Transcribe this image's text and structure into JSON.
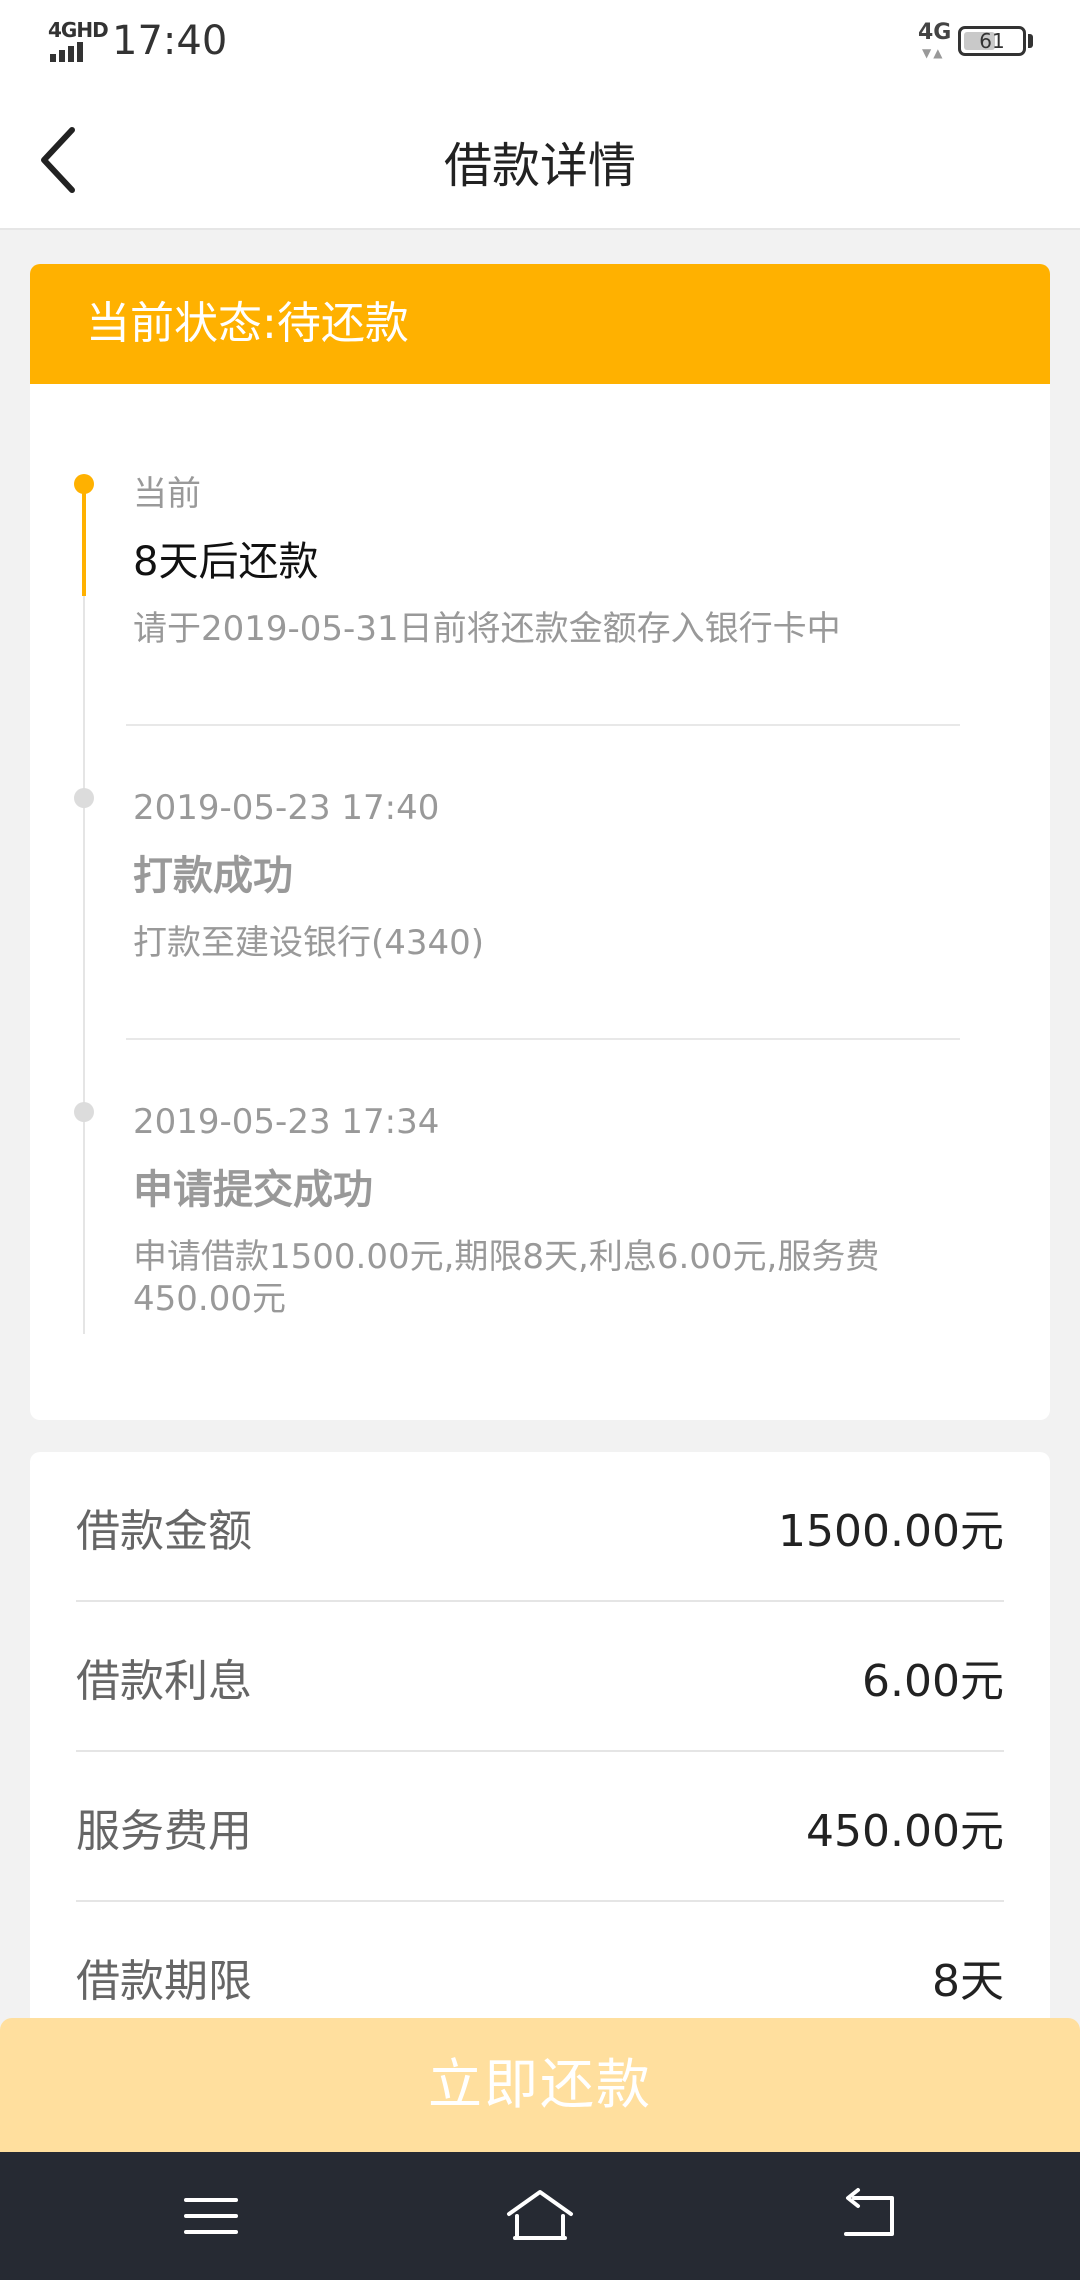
{
  "status_bar": {
    "network_type": "4GHD",
    "time": "17:40",
    "mobile_network": "4G",
    "battery_level": "61"
  },
  "nav": {
    "title": "借款详情",
    "back_icon": "chevron-left-icon"
  },
  "status_card": {
    "header": "当前状态:待还款",
    "accent_color": "#ffb100",
    "timeline": [
      {
        "label": "当前",
        "title": "8天后还款",
        "desc": "请于2019-05-31日前将还款金额存入银行卡中",
        "active": true
      },
      {
        "label": "2019-05-23 17:40",
        "title": "打款成功",
        "desc": "打款至建设银行(4340)",
        "active": false
      },
      {
        "label": "2019-05-23 17:34",
        "title": "申请提交成功",
        "desc": "申请借款1500.00元,期限8天,利息6.00元,服务费450.00元",
        "active": false
      }
    ]
  },
  "details": [
    {
      "key": "借款金额",
      "value": "1500.00元"
    },
    {
      "key": "借款利息",
      "value": "6.00元"
    },
    {
      "key": "服务费用",
      "value": "450.00元"
    },
    {
      "key": "借款期限",
      "value": "8天"
    }
  ],
  "repay_button": {
    "label": "立即还款",
    "color": "#ffdf9e"
  },
  "system_nav": {
    "menu_icon": "menu-icon",
    "home_icon": "home-icon",
    "back_icon": "back-arrow-icon",
    "background": "#262a33"
  }
}
